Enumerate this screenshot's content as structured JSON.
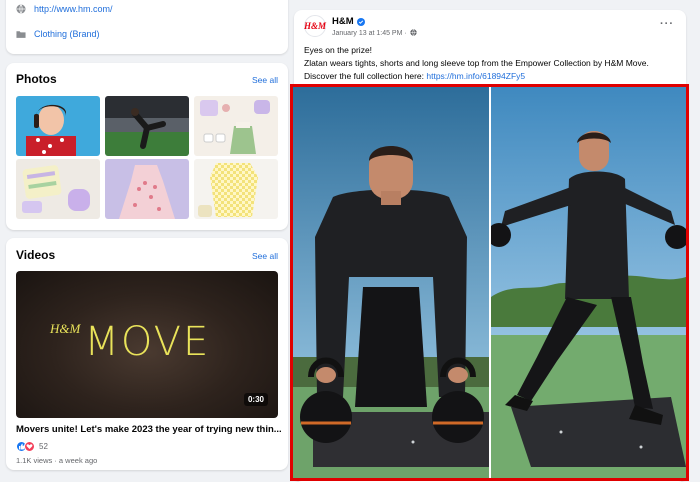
{
  "intro": {
    "website": "http://www.hm.com/",
    "category": "Clothing (Brand)",
    "globe_icon": "globe-icon",
    "folder_icon": "folder-icon"
  },
  "photos": {
    "title": "Photos",
    "see_all": "See all"
  },
  "videos": {
    "title": "Videos",
    "see_all": "See all",
    "thumb_brand": "H&M",
    "thumb_word": "MOVE",
    "duration": "0:30",
    "caption": "Movers unite! Let's make 2023 the year of trying new thin...",
    "reaction_count": "52",
    "meta": "1.1K views · a week ago"
  },
  "post": {
    "author": "H&M",
    "avatar_text": "H&M",
    "timestamp": "January 13 at 1:45 PM ·",
    "more": "···",
    "line1": "Eyes on the prize!",
    "line2": "Zlatan wears tights, shorts and long sleeve top from the Empower Collection by H&M Move.",
    "line3_prefix": "Discover the full collection here: ",
    "line3_link": "https://hm.info/61894ZFy5"
  },
  "colors": {
    "link": "#216fdb",
    "highlight_border": "#e00000",
    "brand_red": "#e50010",
    "move_yellow": "#e9e35a"
  }
}
